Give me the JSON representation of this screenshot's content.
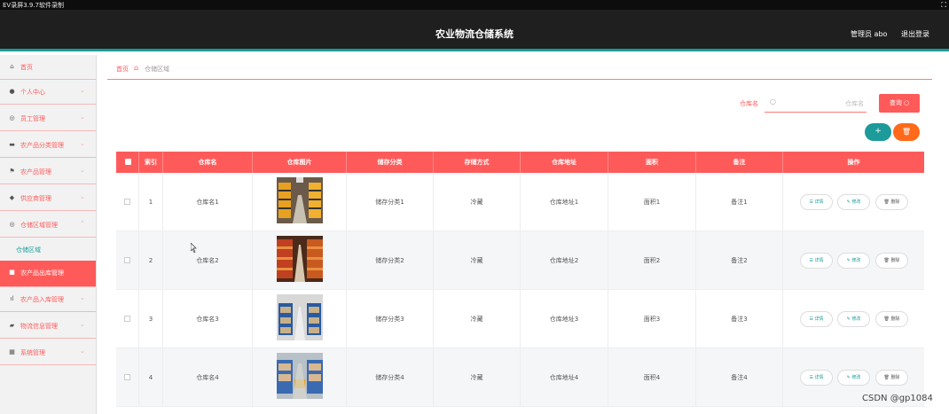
{
  "recorder": {
    "title": "EV录屏3.9.7软件录制",
    "icon": "expand-icon"
  },
  "header": {
    "title": "农业物流仓储系统",
    "user": "管理员 abo",
    "logout": "退出登录"
  },
  "sidebar": {
    "items": [
      {
        "label": "首页",
        "icon": "home-icon",
        "has_chevron": false
      },
      {
        "label": "个人中心",
        "icon": "user-icon",
        "has_chevron": true
      },
      {
        "label": "员工管理",
        "icon": "globe-icon",
        "has_chevron": true
      },
      {
        "label": "农产品分类管理",
        "icon": "card-icon",
        "has_chevron": true
      },
      {
        "label": "农产品管理",
        "icon": "flag-icon",
        "has_chevron": true
      },
      {
        "label": "供应商管理",
        "icon": "pin-icon",
        "has_chevron": true
      },
      {
        "label": "仓储区域管理",
        "icon": "globe-icon",
        "has_chevron": true
      },
      {
        "label": "农产品出库管理",
        "icon": "box-icon",
        "has_chevron": false
      },
      {
        "label": "农产品入库管理",
        "icon": "chart-icon",
        "has_chevron": true
      },
      {
        "label": "物流信息管理",
        "icon": "truck-icon",
        "has_chevron": true
      },
      {
        "label": "系统管理",
        "icon": "grid-icon",
        "has_chevron": true
      }
    ],
    "subitem": "仓储区域"
  },
  "breadcrumb": {
    "home": "首页",
    "current": "仓储区域"
  },
  "search": {
    "label": "仓库名",
    "placeholder": "仓库名",
    "button": "查询 ○"
  },
  "table": {
    "headers": [
      "索引",
      "仓库名",
      "仓库图片",
      "储存分类",
      "存储方式",
      "仓库地址",
      "面积",
      "备注",
      "操作"
    ],
    "rows": [
      {
        "index": "1",
        "name": "仓库名1",
        "category": "储存分类1",
        "method": "冷藏",
        "address": "仓库地址1",
        "area": "面积1",
        "note": "备注1"
      },
      {
        "index": "2",
        "name": "仓库名2",
        "category": "储存分类2",
        "method": "冷藏",
        "address": "仓库地址2",
        "area": "面积2",
        "note": "备注2"
      },
      {
        "index": "3",
        "name": "仓库名3",
        "category": "储存分类3",
        "method": "冷藏",
        "address": "仓库地址3",
        "area": "面积3",
        "note": "备注3"
      },
      {
        "index": "4",
        "name": "仓库名4",
        "category": "储存分类4",
        "method": "冷藏",
        "address": "仓库地址4",
        "area": "面积4",
        "note": "备注4"
      }
    ],
    "actions": {
      "detail": "☰ 详情",
      "edit": "✎ 修改",
      "delete": "🗑 删除"
    }
  },
  "watermark": "CSDN @gp1084"
}
